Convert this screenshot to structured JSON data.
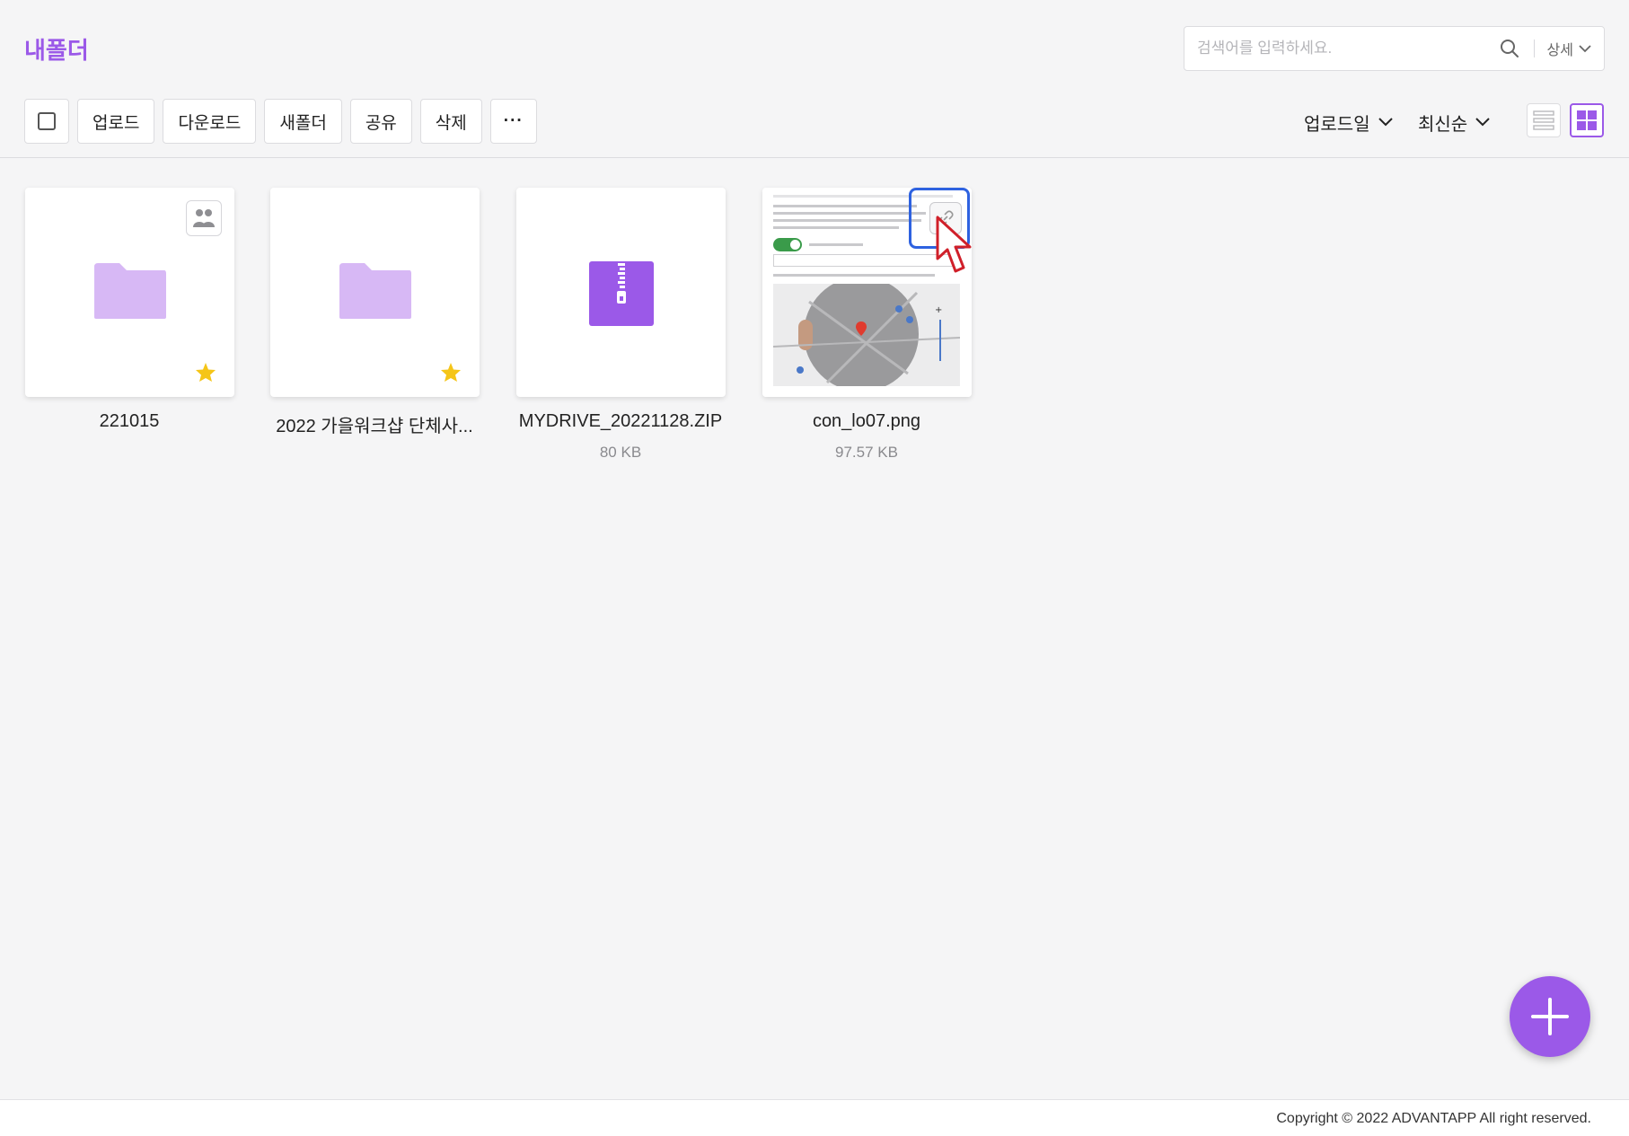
{
  "page": {
    "title": "내폴더"
  },
  "search": {
    "placeholder": "검색어를 입력하세요.",
    "value": "",
    "detail_label": "상세"
  },
  "toolbar": {
    "upload": "업로드",
    "download": "다운로드",
    "new_folder": "새폴더",
    "share": "공유",
    "delete": "삭제",
    "more": "···"
  },
  "sort": {
    "field": "업로드일",
    "order": "최신순"
  },
  "view": {
    "mode": "grid"
  },
  "items": [
    {
      "name": "221015",
      "type": "folder",
      "starred": true,
      "shared": true,
      "size": ""
    },
    {
      "name": "2022 가을워크샵 단체사...",
      "type": "folder",
      "starred": true,
      "shared": false,
      "size": ""
    },
    {
      "name": "MYDRIVE_20221128.ZIP",
      "type": "zip",
      "starred": false,
      "shared": false,
      "size": "80 KB"
    },
    {
      "name": "con_lo07.png",
      "type": "image",
      "starred": false,
      "shared": false,
      "size": "97.57 KB"
    }
  ],
  "colors": {
    "accent": "#9b59e8",
    "folder": "#d7b8f5",
    "star": "#f5c518",
    "highlight": "#2e62e0"
  },
  "footer": {
    "copyright": "Copyright © 2022 ADVANTAPP All right reserved."
  }
}
